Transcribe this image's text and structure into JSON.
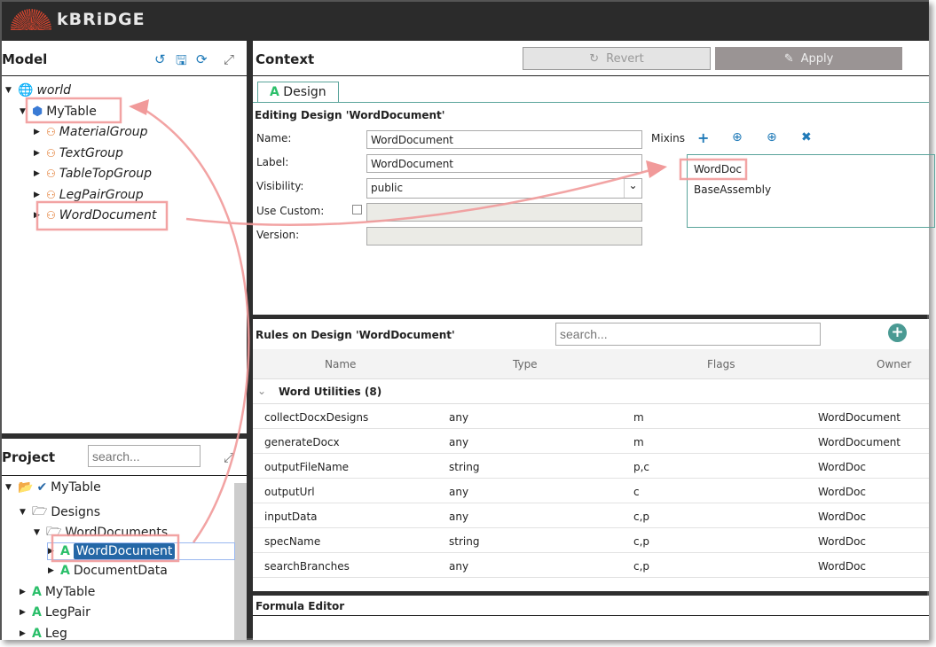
{
  "app": {
    "brand": "kBRiDGE"
  },
  "model": {
    "title": "Model",
    "icons": [
      "history-icon",
      "save-icon",
      "refresh-icon",
      "expand-icon"
    ],
    "tree": [
      {
        "label": "world",
        "level": 0,
        "icon": "globe-icon",
        "expanded": true
      },
      {
        "label": "MyTable",
        "level": 1,
        "icon": "cube-icon",
        "expanded": true
      },
      {
        "label": "MaterialGroup",
        "level": 2,
        "icon": "hierarchy-icon"
      },
      {
        "label": "TextGroup",
        "level": 2,
        "icon": "hierarchy-icon"
      },
      {
        "label": "TableTopGroup",
        "level": 2,
        "icon": "hierarchy-icon"
      },
      {
        "label": "LegPairGroup",
        "level": 2,
        "icon": "hierarchy-icon"
      },
      {
        "label": "WordDocument",
        "level": 2,
        "icon": "hierarchy-icon"
      }
    ]
  },
  "project": {
    "title": "Project",
    "search_placeholder": "search...",
    "tree": [
      {
        "label": "MyTable",
        "level": 0
      },
      {
        "label": "Designs",
        "level": 1
      },
      {
        "label": "WordDocuments",
        "level": 2
      },
      {
        "label": "WordDocument",
        "level": 3,
        "selected": true
      },
      {
        "label": "DocumentData",
        "level": 3
      },
      {
        "label": "MyTable",
        "level": 1
      },
      {
        "label": "LegPair",
        "level": 1
      },
      {
        "label": "Leg",
        "level": 1
      }
    ]
  },
  "context": {
    "title": "Context",
    "revert": "Revert",
    "apply": "Apply",
    "tab": "Design",
    "editing": "Editing Design 'WordDocument'",
    "fields": {
      "name_label": "Name:",
      "name": "WordDocument",
      "label_label": "Label:",
      "label": "WordDocument",
      "visibility_label": "Visibility:",
      "visibility": "public",
      "custom_label": "Use Custom:",
      "version_label": "Version:"
    },
    "mixins_label": "Mixins",
    "mixins": [
      "WordDoc",
      "BaseAssembly"
    ]
  },
  "rules": {
    "title": "Rules on Design 'WordDocument'",
    "search_placeholder": "search...",
    "columns": [
      "Name",
      "Type",
      "Flags",
      "Owner"
    ],
    "group": "Word Utilities (8)",
    "rows": [
      [
        "collectDocxDesigns",
        "any",
        "m",
        "WordDocument"
      ],
      [
        "generateDocx",
        "any",
        "m",
        "WordDocument"
      ],
      [
        "outputFileName",
        "string",
        "p,c",
        "WordDoc"
      ],
      [
        "outputUrl",
        "any",
        "c",
        "WordDoc"
      ],
      [
        "inputData",
        "any",
        "c,p",
        "WordDoc"
      ],
      [
        "specName",
        "string",
        "c,p",
        "WordDoc"
      ],
      [
        "searchBranches",
        "any",
        "c,p",
        "WordDoc"
      ]
    ]
  },
  "formula": {
    "title": "Formula Editor"
  },
  "colors": {
    "accent": "#1f7ab8",
    "highlight": "#f4a3a3",
    "selected": "#2467a6",
    "design_icon": "#2bbf6a"
  }
}
